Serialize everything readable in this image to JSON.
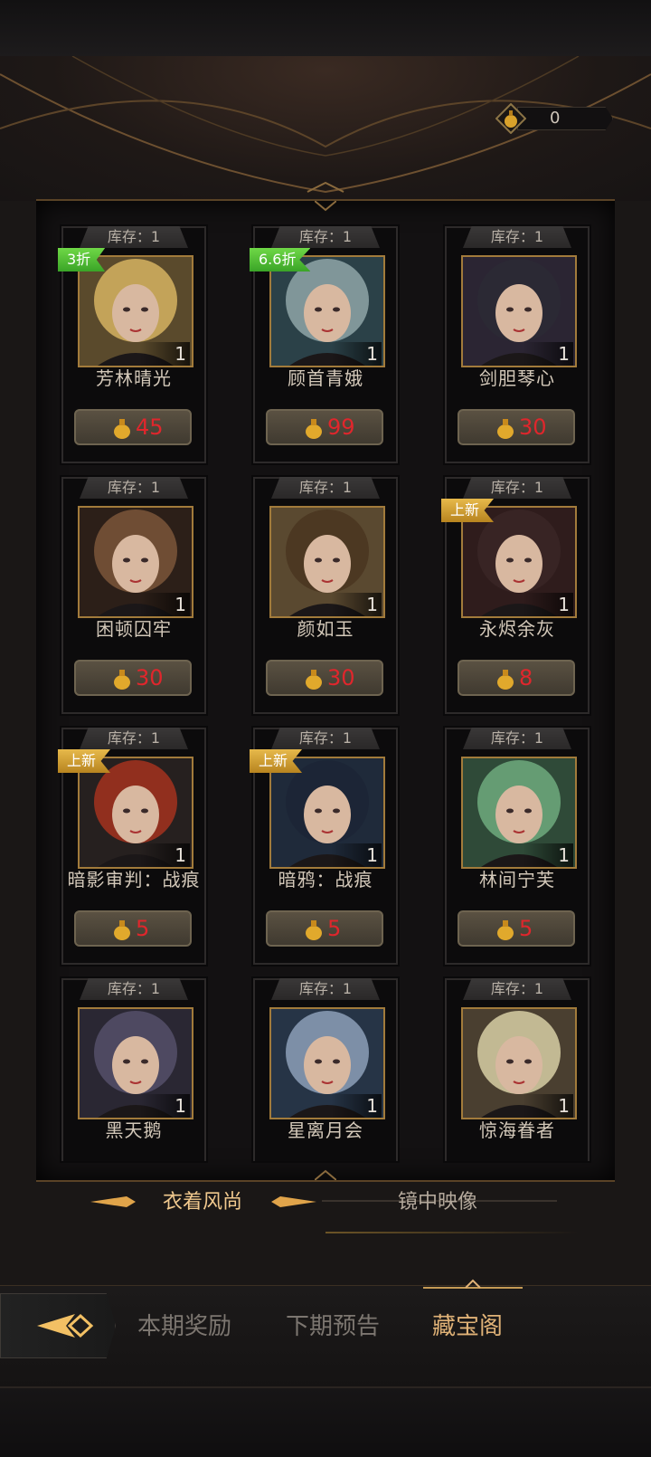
{
  "currency": {
    "amount": "0",
    "icon": "gem-icon"
  },
  "cards": [
    {
      "stock": "库存：1",
      "badge": "3折",
      "badge_color": "#52c035",
      "qty": "1",
      "name": "芳林晴光",
      "price": "45",
      "hair": "#d6b361",
      "bg": "#5a4a2c"
    },
    {
      "stock": "库存：1",
      "badge": "6.6折",
      "badge_color": "#52c035",
      "qty": "1",
      "name": "顾首青娥",
      "price": "99",
      "hair": "#8fa6a8",
      "bg": "#2b4148"
    },
    {
      "stock": "库存：1",
      "badge": "",
      "badge_color": "",
      "qty": "1",
      "name": "剑胆琴心",
      "price": "30",
      "hair": "#2b2a35",
      "bg": "#2b2533"
    },
    {
      "stock": "库存：1",
      "badge": "",
      "badge_color": "",
      "qty": "1",
      "name": "困顿囚牢",
      "price": "30",
      "hair": "#7b5639",
      "bg": "#2c1f18"
    },
    {
      "stock": "库存：1",
      "badge": "",
      "badge_color": "",
      "qty": "1",
      "name": "颜如玉",
      "price": "30",
      "hair": "#4a3520",
      "bg": "#5a4930"
    },
    {
      "stock": "库存：1",
      "badge": "上新",
      "badge_color": "#d4a23a",
      "qty": "1",
      "name": "永烬余灰",
      "price": "8",
      "hair": "#3a2626",
      "bg": "#2f1c1c"
    },
    {
      "stock": "库存：1",
      "badge": "上新",
      "badge_color": "#d4a23a",
      "qty": "1",
      "name": "暗影审判：战痕",
      "price": "5",
      "hair": "#a5321e",
      "bg": "#26201f"
    },
    {
      "stock": "库存：1",
      "badge": "上新",
      "badge_color": "#d4a23a",
      "qty": "1",
      "name": "暗鸦：战痕",
      "price": "5",
      "hair": "#1c2436",
      "bg": "#1f2a3a"
    },
    {
      "stock": "库存：1",
      "badge": "",
      "badge_color": "",
      "qty": "1",
      "name": "林间宁芙",
      "price": "5",
      "hair": "#6faa7e",
      "bg": "#2f4a38"
    },
    {
      "stock": "库存：1",
      "badge": "",
      "badge_color": "",
      "qty": "1",
      "name": "黑天鹅",
      "price": "",
      "hair": "#55506a",
      "bg": "#2a2733"
    },
    {
      "stock": "库存：1",
      "badge": "",
      "badge_color": "",
      "qty": "1",
      "name": "星离月会",
      "price": "",
      "hair": "#8da0b8",
      "bg": "#263446"
    },
    {
      "stock": "库存：1",
      "badge": "",
      "badge_color": "",
      "qty": "1",
      "name": "惊海眷者",
      "price": "",
      "hair": "#d7cfa4",
      "bg": "#4a3f30"
    }
  ],
  "subtabs": {
    "fashion": "衣着风尚",
    "mirror": "镜中映像"
  },
  "nav": {
    "current": "本期奖励",
    "next": "下期预告",
    "treasure": "藏宝阁"
  }
}
